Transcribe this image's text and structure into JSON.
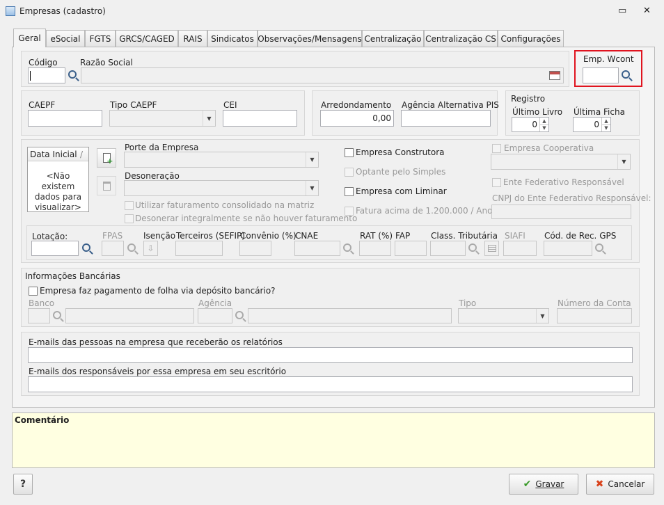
{
  "window": {
    "title": "Empresas (cadastro)",
    "restore_symbol": "▭",
    "close_symbol": "✕"
  },
  "tabs": [
    "Geral",
    "eSocial",
    "FGTS",
    "GRCS/CAGED",
    "RAIS",
    "Sindicatos",
    "Observações/Mensagens",
    "Centralização",
    "Centralização CS",
    "Configurações"
  ],
  "geral": {
    "codigo_label": "Código",
    "razao_label": "Razão Social",
    "emp_wcont_label": "Emp. Wcont"
  },
  "sec2": {
    "caepf_label": "CAEPF",
    "tipo_caepf_label": "Tipo CAEPF",
    "cei_label": "CEI",
    "arredondamento_label": "Arredondamento",
    "arredondamento_value": "0,00",
    "agencia_pis_label": "Agência Alternativa PIS",
    "registro_title": "Registro",
    "ultimo_livro_label": "Último Livro",
    "ultimo_livro_value": "0",
    "ultima_ficha_label": "Última Ficha",
    "ultima_ficha_value": "0"
  },
  "sec3": {
    "grid_header": "Data Inicial",
    "grid_sort": "/",
    "empty_text": "<Não existem dados para visualizar>",
    "porte_label": "Porte da Empresa",
    "desoneracao_label": "Desoneração",
    "fat_consolidado_label": "Utilizar faturamento consolidado na matriz",
    "desonerar_label": "Desonerar integralmente se não houver faturamento",
    "construtora_label": "Empresa Construtora",
    "simples_label": "Optante pelo Simples",
    "liminar_label": "Empresa com Liminar",
    "fatura_label": "Fatura acima de 1.200.000 / Ano",
    "cooperativa_label": "Empresa Cooperativa",
    "ente_label": "Ente Federativo Responsável",
    "cnpj_ente_label": "CNPJ do Ente Federativo Responsável:"
  },
  "lotacao": {
    "lotacao_label": "Lotação:",
    "fpas_label": "FPAS",
    "isencao_label": "Isenção",
    "terceiros_label": "Terceiros (SEFIP)",
    "convenio_label": "Convênio (%)",
    "cnae_label": "CNAE",
    "rat_label": "RAT (%)",
    "fap_label": "FAP",
    "class_trib_label": "Class. Tributária",
    "siafi_label": "SIAFI",
    "cod_rec_label": "Cód. de Rec. GPS"
  },
  "bancarias": {
    "title": "Informações Bancárias",
    "pagamento_label": "Empresa faz pagamento de folha via depósito bancário?",
    "banco_label": "Banco",
    "agencia_label": "Agência",
    "tipo_label": "Tipo",
    "numero_conta_label": "Número da Conta"
  },
  "emails": {
    "pessoas_label": "E-mails das pessoas na empresa que receberão os relatórios",
    "responsaveis_label": "E-mails dos responsáveis por essa empresa em seu escritório"
  },
  "comentario": {
    "label": "Comentário"
  },
  "footer": {
    "help": "?",
    "gravar": "Gravar",
    "cancelar": "Cancelar"
  },
  "colors": {
    "highlight": "#e0141f",
    "comment_bg": "#ffffe1"
  }
}
